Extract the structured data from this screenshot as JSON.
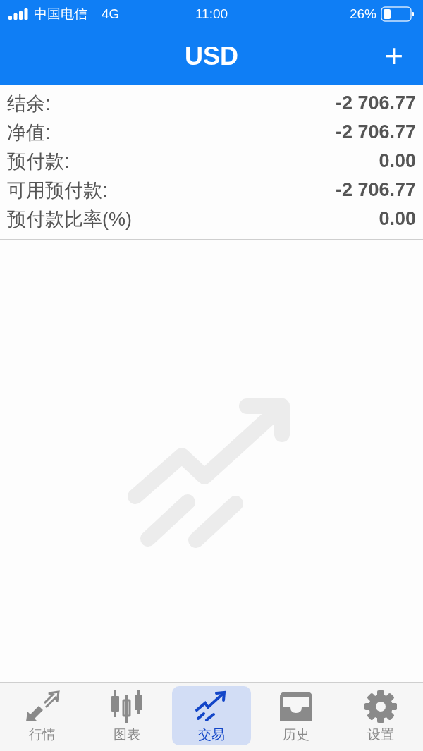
{
  "status_bar": {
    "carrier": "中国电信",
    "network": "4G",
    "time": "11:00",
    "battery": "26%"
  },
  "header": {
    "title": "USD",
    "add_button": "+"
  },
  "summary": [
    {
      "label": "结余:",
      "value": "-2 706.77"
    },
    {
      "label": "净值:",
      "value": "-2 706.77"
    },
    {
      "label": "预付款:",
      "value": "0.00"
    },
    {
      "label": "可用预付款:",
      "value": "-2 706.77"
    },
    {
      "label": "预付款比率(%)",
      "value": "0.00"
    }
  ],
  "tabs": [
    {
      "label": "行情",
      "kind": "quotes",
      "selected": false
    },
    {
      "label": "图表",
      "kind": "chart",
      "selected": false
    },
    {
      "label": "交易",
      "kind": "trade",
      "selected": true
    },
    {
      "label": "历史",
      "kind": "history",
      "selected": false
    },
    {
      "label": "设置",
      "kind": "settings",
      "selected": false
    }
  ]
}
